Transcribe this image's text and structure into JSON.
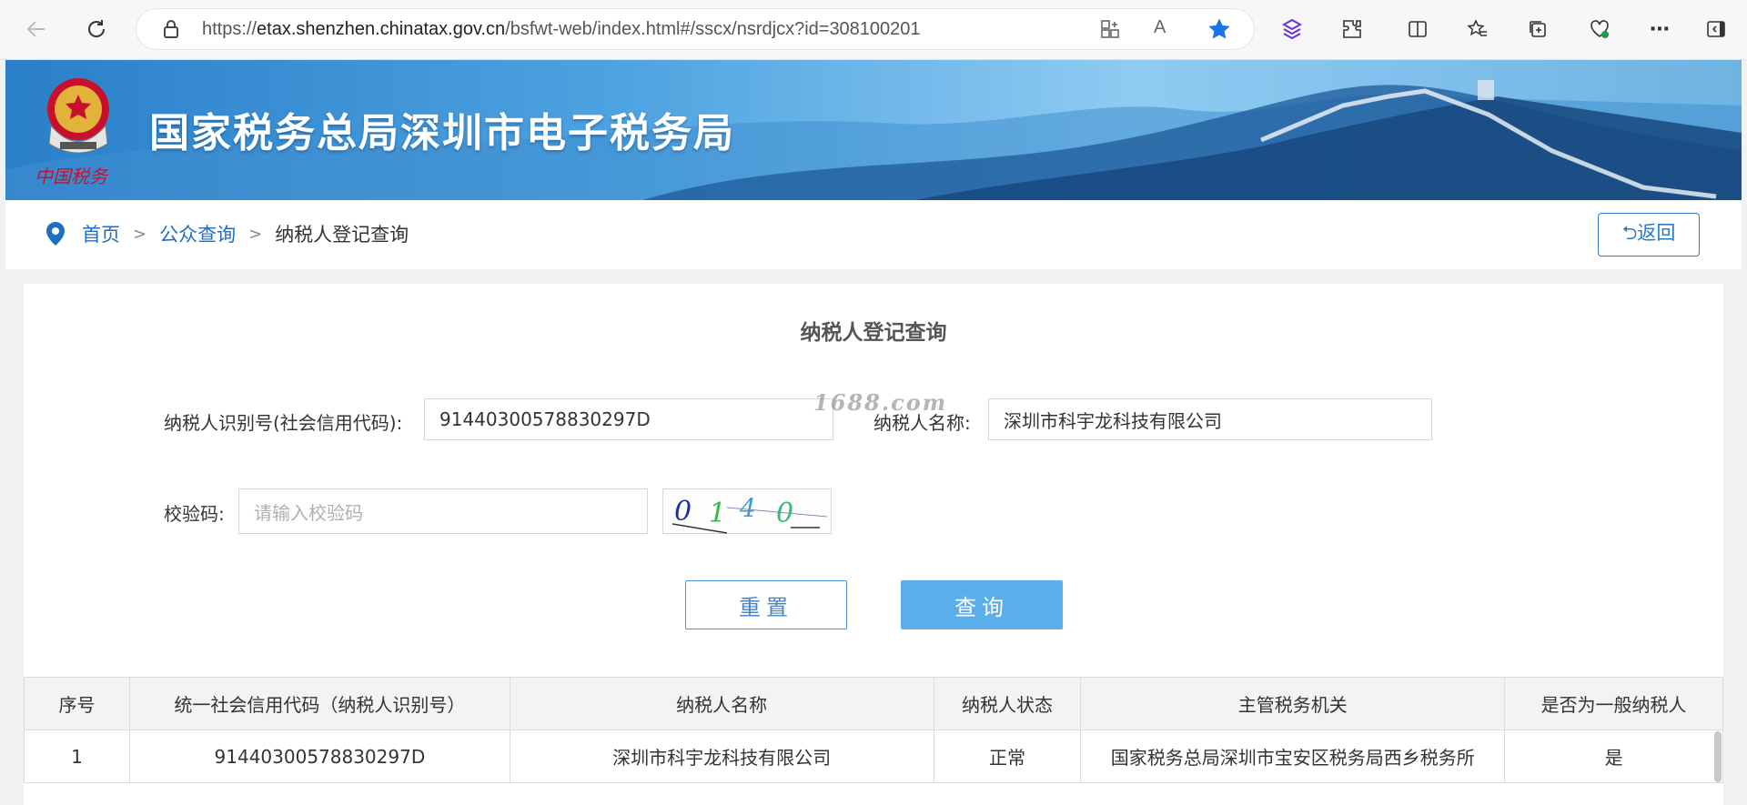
{
  "browser": {
    "url_prefix": "https://",
    "url_host": "etax.shenzhen.chinatax.gov.cn",
    "url_path": "/bsfwt-web/index.html#/sscx/nsrdjcx?id=308100201"
  },
  "banner": {
    "title": "国家税务总局深圳市电子税务局",
    "logo_caption": "中国税务"
  },
  "breadcrumb": {
    "home": "首页",
    "public_query": "公众查询",
    "current": "纳税人登记查询",
    "separator": ">"
  },
  "back_button": "⮌返回",
  "form": {
    "title": "纳税人登记查询",
    "taxpayer_id_label": "纳税人识别号(社会信用代码):",
    "taxpayer_id_value": "91440300578830297D",
    "taxpayer_name_label": "纳税人名称:",
    "taxpayer_name_value": "深圳市科宇龙科技有限公司",
    "captcha_label": "校验码:",
    "captcha_placeholder": "请输入校验码",
    "captcha_text": "0140",
    "reset_button": "重置",
    "query_button": "查询"
  },
  "watermark": "1688.com",
  "table": {
    "headers": [
      "序号",
      "统一社会信用代码（纳税人识别号）",
      "纳税人名称",
      "纳税人状态",
      "主管税务机关",
      "是否为一般纳税人"
    ],
    "rows": [
      [
        "1",
        "91440300578830297D",
        "深圳市科宇龙科技有限公司",
        "正常",
        "国家税务总局深圳市宝安区税务局西乡税务所",
        "是"
      ]
    ]
  },
  "colors": {
    "link": "#1e6fc2",
    "primary_button": "#5aaeea",
    "favorite_star": "#1a73e8"
  }
}
